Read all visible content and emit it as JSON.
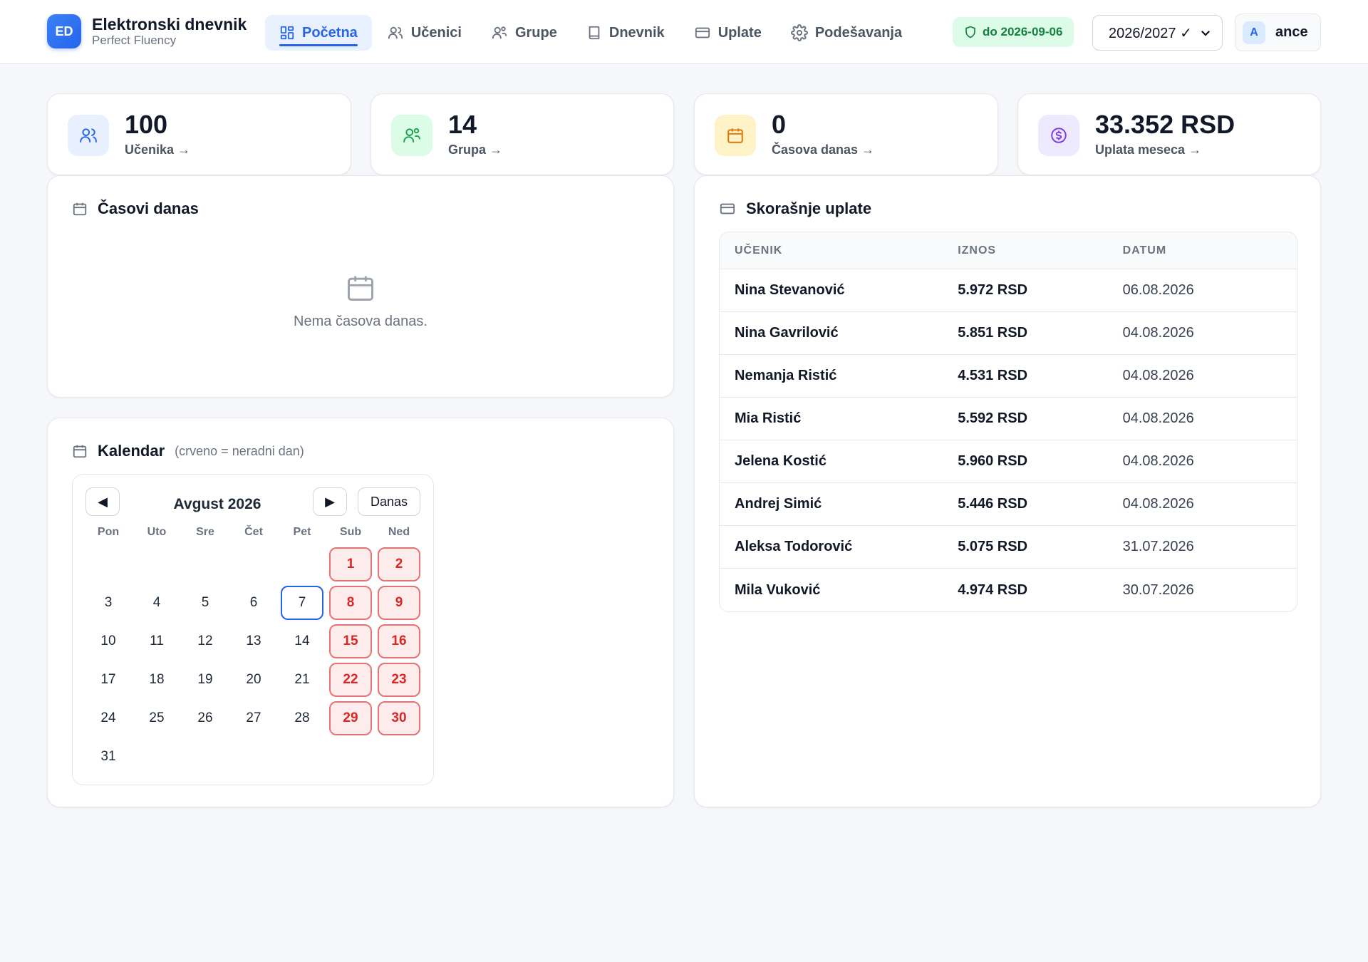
{
  "brand": {
    "logo": "ED",
    "title": "Elektronski dnevnik",
    "subtitle": "Perfect Fluency"
  },
  "nav": [
    {
      "label": "Početna",
      "icon": "dashboard-icon",
      "active": true
    },
    {
      "label": "Učenici",
      "icon": "users-icon"
    },
    {
      "label": "Grupe",
      "icon": "groups-icon"
    },
    {
      "label": "Dnevnik",
      "icon": "book-icon"
    },
    {
      "label": "Uplate",
      "icon": "credit-card-icon"
    },
    {
      "label": "Podešavanja",
      "icon": "gear-icon"
    }
  ],
  "license": {
    "label": "do 2026-09-06",
    "icon": "shield-icon"
  },
  "year_select": {
    "value": "2026/2027 ✓",
    "icon": "chevron-down-icon"
  },
  "user": {
    "avatar": "A",
    "name": "ance"
  },
  "stats": [
    {
      "value": "100",
      "label": "Učenika →",
      "icon": "users-icon",
      "color": "#2563eb",
      "bg": "#e8f0fe"
    },
    {
      "value": "14",
      "label": "Grupa →",
      "icon": "groups-icon",
      "color": "#16a34a",
      "bg": "#dcfce7"
    },
    {
      "value": "0",
      "label": "Časova danas →",
      "icon": "calendar-icon",
      "color": "#d97706",
      "bg": "#fef3c7"
    },
    {
      "value": "33.352 RSD",
      "label": "Uplata meseca →",
      "icon": "dollar-icon",
      "color": "#7c3aed",
      "bg": "#ede9fe"
    }
  ],
  "lessons_today": {
    "title": "Časovi danas",
    "empty_text": "Nema časova danas."
  },
  "calendar": {
    "title": "Kalendar",
    "hint": "(crveno = neradni dan)",
    "month_label": "Avgust 2026",
    "prev_label": "◀",
    "next_label": "▶",
    "today_label": "Danas",
    "weekdays": [
      "Pon",
      "Uto",
      "Sre",
      "Čet",
      "Pet",
      "Sub",
      "Ned"
    ],
    "first_weekday_index": 5,
    "days_in_month": 31,
    "today": 7,
    "non_working_days": [
      1,
      2,
      8,
      9,
      15,
      16,
      22,
      23,
      29,
      30
    ]
  },
  "payments": {
    "title": "Skorašnje uplate",
    "headers": [
      "UČENIK",
      "IZNOS",
      "DATUM"
    ],
    "rows": [
      [
        "Nina Stevanović",
        "5.972 RSD",
        "06.08.2026"
      ],
      [
        "Nina Gavrilović",
        "5.851 RSD",
        "04.08.2026"
      ],
      [
        "Nemanja Ristić",
        "4.531 RSD",
        "04.08.2026"
      ],
      [
        "Mia Ristić",
        "5.592 RSD",
        "04.08.2026"
      ],
      [
        "Jelena Kostić",
        "5.960 RSD",
        "04.08.2026"
      ],
      [
        "Andrej Simić",
        "5.446 RSD",
        "04.08.2026"
      ],
      [
        "Aleksa Todorović",
        "5.075 RSD",
        "31.07.2026"
      ],
      [
        "Mila Vuković",
        "4.974 RSD",
        "30.07.2026"
      ]
    ]
  }
}
